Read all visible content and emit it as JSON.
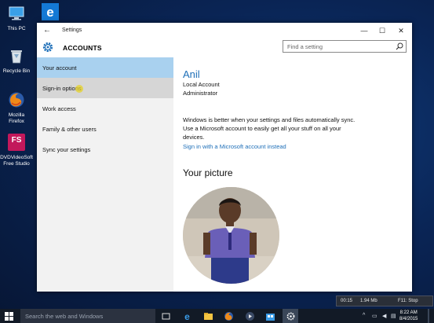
{
  "desktop": {
    "icons": [
      {
        "label": "This PC"
      },
      {
        "label": ""
      },
      {
        "label": "Recycle Bin"
      },
      {
        "label": "Mozilla Firefox",
        "line1": "Mozilla",
        "line2": "Firefox"
      },
      {
        "label": "DVDVideoSoft Free Studio",
        "line1": "DVDVideoSoft",
        "line2": "Free Studio",
        "glyph": "FS"
      }
    ]
  },
  "window": {
    "title": "Settings",
    "back": "←",
    "minimize": "—",
    "maximize": "☐",
    "close": "✕"
  },
  "header": {
    "section": "ACCOUNTS",
    "search_placeholder": "Find a setting"
  },
  "sidebar": {
    "items": [
      {
        "label": "Your account"
      },
      {
        "label": "Sign-in options"
      },
      {
        "label": "Work access"
      },
      {
        "label": "Family & other users"
      },
      {
        "label": "Sync your settings"
      }
    ]
  },
  "content": {
    "name": "Anil",
    "account_type": "Local Account",
    "role": "Administrator",
    "sync_text_1": "Windows is better when your settings and files automatically sync.",
    "sync_text_2": "Use a Microsoft account to easily get all your stuff on all your",
    "sync_text_3": "devices.",
    "ms_link": "Sign in with a Microsoft account instead",
    "picture_heading": "Your picture"
  },
  "recorder": {
    "time": "00:15",
    "size": "1.94 Mb",
    "hint": "F11: Stop"
  },
  "taskbar": {
    "search_placeholder": "Search the web and Windows",
    "clock_time": "8:22 AM",
    "clock_date": "8/4/2015"
  },
  "colors": {
    "accent": "#1e6fb8",
    "selected_nav": "#a9d1ef"
  }
}
